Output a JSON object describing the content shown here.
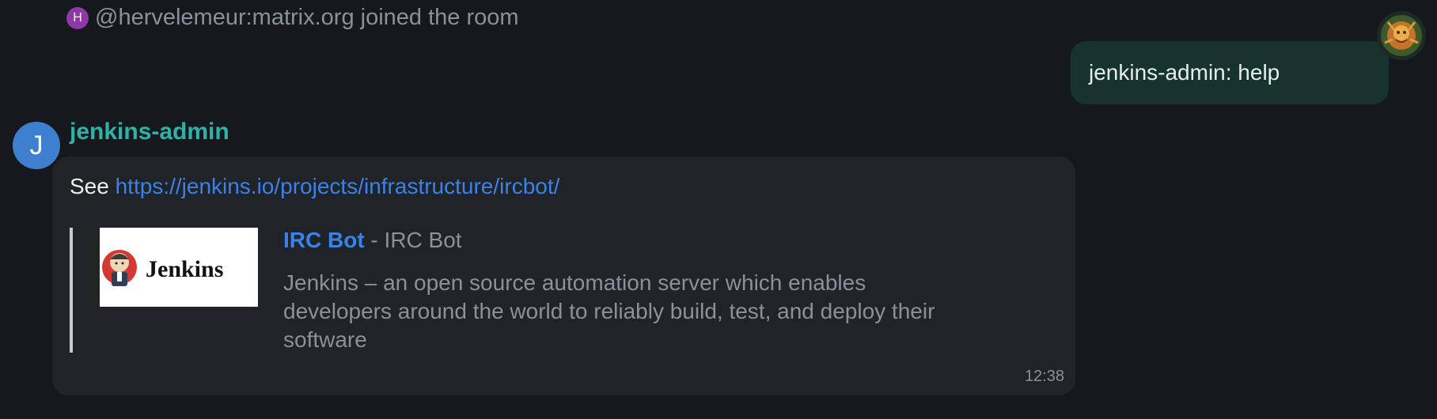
{
  "event": {
    "avatar_letter": "H",
    "text": "@hervelemeur:matrix.org joined the room"
  },
  "own_message": {
    "text": "jenkins-admin: help"
  },
  "incoming_message": {
    "avatar_letter": "J",
    "sender": "jenkins-admin",
    "prefix": "See ",
    "link": "https://jenkins.io/projects/infrastructure/ircbot/",
    "preview": {
      "image_text": "Jenkins",
      "site": "IRC Bot",
      "title_suffix": " - IRC Bot",
      "description": "Jenkins – an open source automation server which enables developers around the world to reliably build, test, and deploy their software"
    },
    "time": "12:38"
  },
  "colors": {
    "background": "#15191e",
    "own_bubble": "#16332f",
    "incoming_bubble": "#202328",
    "sender": "#2eb3a8",
    "link": "#3b82e8"
  }
}
